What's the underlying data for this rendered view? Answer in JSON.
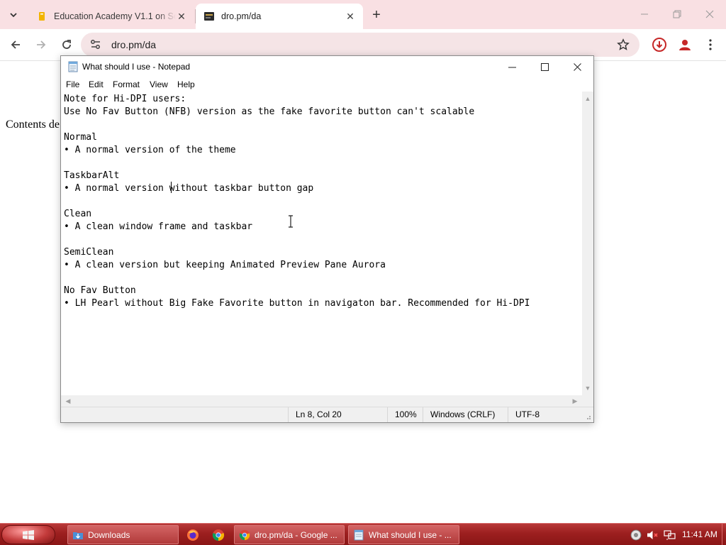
{
  "browser": {
    "tabs": [
      {
        "title": "Education Academy V1.1 on Sc",
        "active": false
      },
      {
        "title": "dro.pm/da",
        "active": true
      }
    ],
    "address": "dro.pm/da"
  },
  "page": {
    "visible_text": "Contents de"
  },
  "notepad": {
    "title": "What should I use - Notepad",
    "menu": [
      "File",
      "Edit",
      "Format",
      "View",
      "Help"
    ],
    "lines": [
      "Note for Hi-DPI users:",
      "Use No Fav Button (NFB) version as the fake favorite button can't scalable",
      "",
      "Normal",
      "• A normal version of the theme",
      "",
      "TaskbarAlt",
      "• A normal version without taskbar button gap",
      "",
      "Clean",
      "• A clean window frame and taskbar",
      "",
      "SemiClean",
      "• A clean version but keeping Animated Preview Pane Aurora",
      "",
      "No Fav Button",
      "• LH Pearl without Big Fake Favorite button in navigaton bar. Recommended for Hi-DPI"
    ],
    "status": {
      "position": "Ln 8, Col 20",
      "zoom": "100%",
      "line_ending": "Windows (CRLF)",
      "encoding": "UTF-8"
    }
  },
  "taskbar": {
    "tasks": [
      {
        "label": "Downloads",
        "icon": "folder-download-icon"
      },
      {
        "label": "dro.pm/da - Google ...",
        "icon": "chrome-icon"
      },
      {
        "label": "What should I use - ...",
        "icon": "notepad-icon"
      }
    ],
    "pinned": [
      "firefox-icon",
      "chrome-icon"
    ],
    "clock": "11:41 AM"
  }
}
